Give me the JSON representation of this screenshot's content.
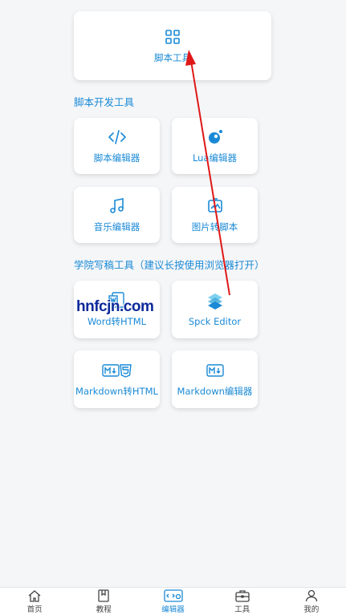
{
  "top_card": {
    "label": "脚本工具"
  },
  "sections": {
    "dev": "脚本开发工具",
    "college": "学院写稿工具（建议长按使用浏览器打开）"
  },
  "cards": {
    "script_editor": "脚本编辑器",
    "lua_editor": "Lua编辑器",
    "music_editor": "音乐编辑器",
    "image_to_script": "图片转脚本",
    "word_to_html": "Word转HTML",
    "spck_editor": "Spck Editor",
    "markdown_to_html": "Markdown转HTML",
    "markdown_editor": "Markdown编辑器"
  },
  "watermark": "hnfcjn.com",
  "nav": {
    "home": "首页",
    "tutorial": "教程",
    "editor": "编辑器",
    "tools": "工具",
    "mine": "我的"
  },
  "colors": {
    "accent": "#1a8ad6",
    "arrow": "#e01818"
  }
}
